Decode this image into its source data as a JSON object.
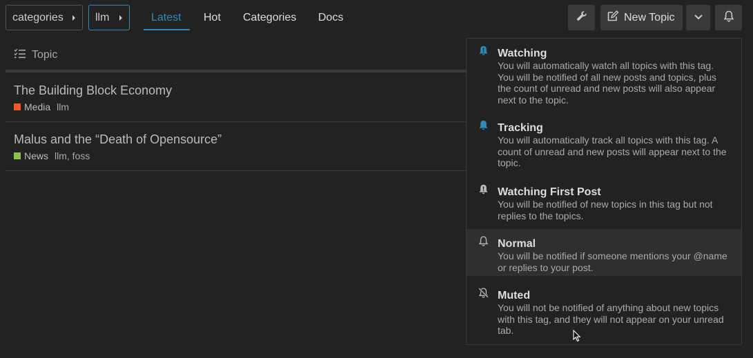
{
  "breadcrumbs": {
    "category": "categories",
    "tag": "llm"
  },
  "nav": {
    "latest": "Latest",
    "hot": "Hot",
    "categories": "Categories",
    "docs": "Docs"
  },
  "toolbar": {
    "new_topic": "New Topic"
  },
  "topic_list": {
    "header": "Topic",
    "rows": [
      {
        "title": "The Building Block Economy",
        "category": "Media",
        "category_color": "#f1592a",
        "tags": "llm"
      },
      {
        "title": "Malus and the “Death of Opensource”",
        "category": "News",
        "category_color": "#8bc34a",
        "tags": "llm, foss"
      }
    ]
  },
  "notification_menu": {
    "options": [
      {
        "title": "Watching",
        "description": "You will automatically watch all topics with this tag. You will be notified of all new posts and topics, plus the count of unread and new posts will also appear next to the topic.",
        "icon": "bell-exclamation-icon"
      },
      {
        "title": "Tracking",
        "description": "You will automatically track all topics with this tag. A count of unread and new posts will appear next to the topic.",
        "icon": "bell-icon"
      },
      {
        "title": "Watching First Post",
        "description": "You will be notified of new topics in this tag but not replies to the topics.",
        "icon": "bell-exclamation-icon"
      },
      {
        "title": "Normal",
        "description": "You will be notified if someone mentions your @name or replies to your post.",
        "icon": "bell-outline-icon"
      },
      {
        "title": "Muted",
        "description": "You will not be notified of anything about new topics with this tag, and they will not appear on your unread tab.",
        "icon": "bell-slash-icon"
      }
    ]
  },
  "colors": {
    "accent": "#2e8ab8",
    "background": "#222222"
  }
}
